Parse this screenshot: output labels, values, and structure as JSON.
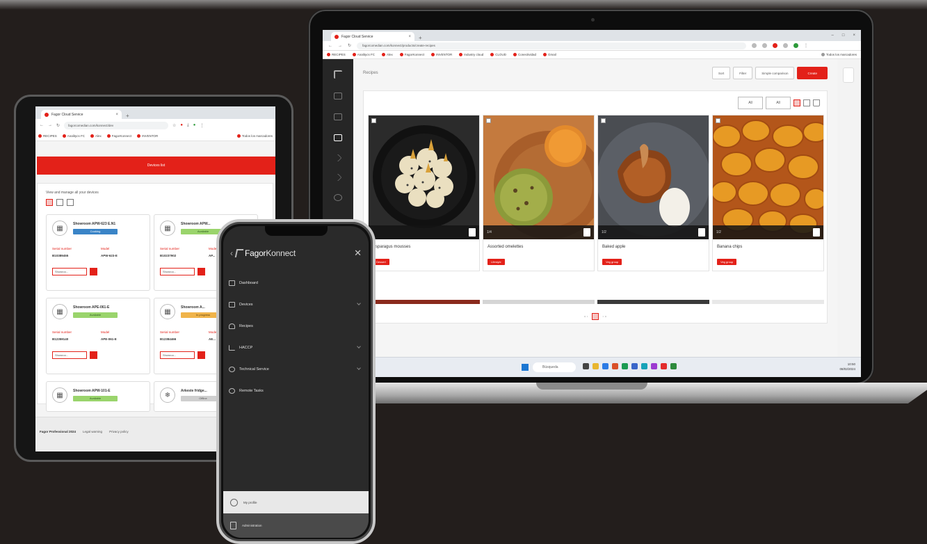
{
  "laptop": {
    "browser": {
      "tab_title": "Fagor Cloud Service",
      "address": "fagorcomedian.com/konnect/products/create-recipes",
      "bookmarks": [
        "RECIPES",
        "Analitycs FC",
        "Alex",
        "FagorKonnect",
        "INVENTOR",
        "Industry cloud",
        "CLOUD",
        "Conectividad",
        "Gmail"
      ],
      "bookmarks_right": "Todos los marcadores"
    },
    "page_title": "Recipes",
    "toolbar": {
      "sort_label": "Sort",
      "filter_label": "Filter",
      "compare_label": "Simple comparison",
      "create_label": "Create"
    },
    "filters": {
      "select1": "All",
      "select2": "All"
    },
    "recipes": [
      {
        "name": "Asparagus mousses",
        "count": "",
        "tag": "Dessert"
      },
      {
        "name": "Assorted omelettes",
        "count": "1/4",
        "tag": "Lifestyle"
      },
      {
        "name": "Baked apple",
        "count": "1/2",
        "tag": "Veg group"
      },
      {
        "name": "Banana chips",
        "count": "1/2",
        "tag": "Veg group"
      }
    ],
    "pagination": {
      "prev": "« ‹",
      "current": "1",
      "next": "› »"
    },
    "taskbar": {
      "search": "Búsqueda",
      "time": "10:50",
      "date": "08/02/2024"
    }
  },
  "tablet": {
    "browser": {
      "tab_title": "Fagor Cloud Service",
      "address": "fagorcomedian.com/konnect/dev",
      "bookmarks": [
        "RECIPES",
        "Analitycs FC",
        "Alex",
        "FagorKonnect",
        "INVENTOR"
      ],
      "bookmarks_right": "Todos los marcadores"
    },
    "add_button": "Devices list",
    "subtitle": "View and manage all your devices",
    "devices": [
      {
        "name": "Showroom APW-623 E.N1",
        "status": "Cooking",
        "status_class": "st-blue",
        "serial_label": "Serial number",
        "serial": "B10389455",
        "model_label": "Model",
        "model": "APW-623-E",
        "select": "Showroo..."
      },
      {
        "name": "Showroom APW...",
        "status": "Available",
        "status_class": "st-green",
        "serial_label": "Serial number",
        "serial": "B10237902",
        "model_label": "Model",
        "model": "AP...",
        "select": "Showroo..."
      },
      {
        "name": "Showroom APE-061-E",
        "status": "Available",
        "status_class": "st-green",
        "serial_label": "Serial number",
        "serial": "B12359140",
        "model_label": "Model",
        "model": "APE-061-E",
        "select": "Showroo..."
      },
      {
        "name": "Showroom A...",
        "status": "In progress",
        "status_class": "st-orange",
        "serial_label": "Serial number",
        "serial": "B12384466",
        "model_label": "Model",
        "model": "AE...",
        "select": "Showroo..."
      },
      {
        "name": "Showroom APW-101-E",
        "status": "Available",
        "status_class": "st-green",
        "serial_label": "",
        "serial": "",
        "model_label": "",
        "model": "",
        "select": ""
      },
      {
        "name": "Arkeste fridge...",
        "status": "Offline",
        "status_class": "st-gray",
        "serial_label": "",
        "serial": "",
        "model_label": "",
        "model": "",
        "select": ""
      }
    ],
    "footer": {
      "brand": "Fagor Professional 2024",
      "legal": "Legal warning",
      "privacy": "Privacy policy"
    }
  },
  "phone": {
    "logo_part1": "Fagor",
    "logo_part2": "Konnect",
    "menu": [
      {
        "label": "Dashboard",
        "expandable": false
      },
      {
        "label": "Devices",
        "expandable": true
      },
      {
        "label": "Recipes",
        "expandable": false
      },
      {
        "label": "HACCP",
        "expandable": true
      },
      {
        "label": "Technical Service",
        "expandable": true
      },
      {
        "label": "Remote Tasks",
        "expandable": false
      }
    ],
    "profile": "My profile",
    "admin": "Administration"
  },
  "colors": {
    "brand_red": "#e32119",
    "sidebar_dark": "#262626",
    "backdrop": "#231e1c"
  }
}
